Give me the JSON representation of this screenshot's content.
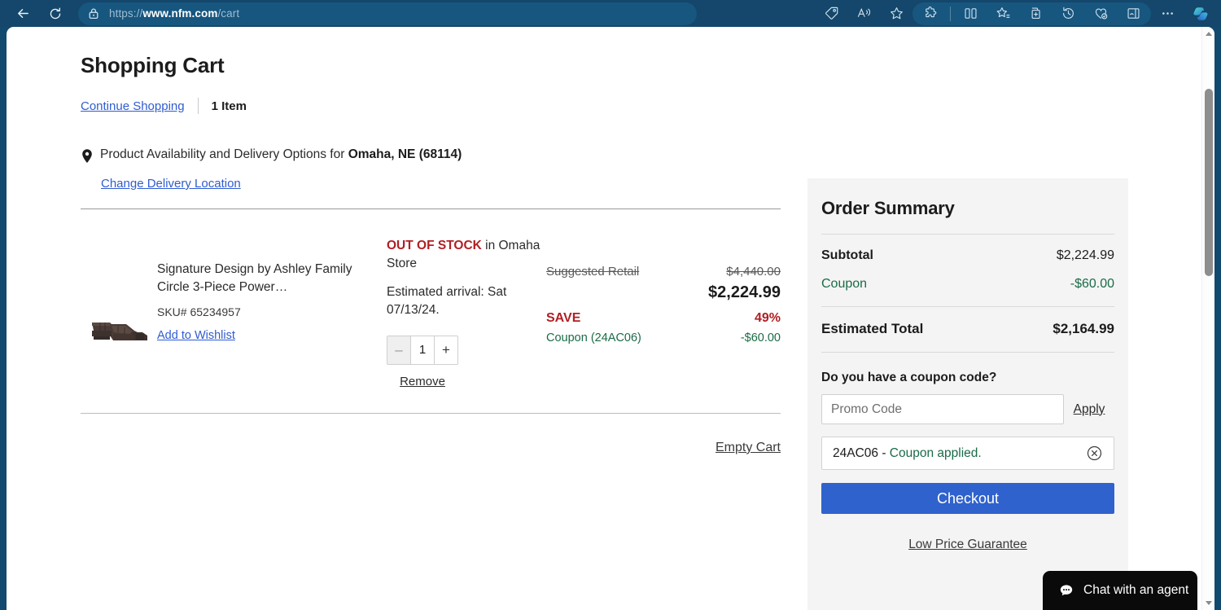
{
  "browser": {
    "url_prefix": "https://",
    "url_domain": "www.nfm.com",
    "url_path": "/cart",
    "back_icon": "back-arrow-icon",
    "refresh_icon": "refresh-icon",
    "lock_icon": "site-info-lock-icon",
    "toolbar_icons": [
      "price-tag-icon",
      "read-aloud-icon",
      "favorites-star-icon",
      "extensions-puzzle-icon",
      "split-screen-icon",
      "collections-star-icon",
      "add-to-collections-icon",
      "history-icon",
      "browser-essentials-icon",
      "sidebar-toggle-icon",
      "settings-more-icon",
      "copilot-icon"
    ]
  },
  "page": {
    "title": "Shopping Cart",
    "continue_shopping": "Continue Shopping",
    "item_count": "1 Item",
    "availability_prefix": "Product Availability and Delivery Options for ",
    "availability_location": "Omaha, NE (68114)",
    "change_location": "Change Delivery Location",
    "empty_cart": "Empty Cart"
  },
  "item": {
    "thumbnail": "sectional-sofa-thumbnail",
    "name": "Signature Design by Ashley Family Circle 3-Piece Power…",
    "sku": "SKU# 65234957",
    "add_to_wishlist": "Add to Wishlist",
    "stock_status": "OUT OF STOCK",
    "stock_suffix": " in Omaha Store",
    "estimated_arrival": "Estimated arrival: Sat 07/13/24.",
    "qty_minus": "–",
    "qty_value": "1",
    "qty_plus": "+",
    "remove": "Remove",
    "suggested_retail_label": "Suggested Retail",
    "suggested_retail_value": "$4,440.00",
    "current_price": "$2,224.99",
    "save_label": "SAVE",
    "save_percent": "49%",
    "coupon_label": "Coupon (24AC06)",
    "coupon_value": "-$60.00"
  },
  "summary": {
    "title": "Order Summary",
    "rows": [
      {
        "label": "Subtotal",
        "value": "$2,224.99",
        "green": false
      },
      {
        "label": "Coupon",
        "value": "-$60.00",
        "green": true
      }
    ],
    "total_label": "Estimated Total",
    "total_value": "$2,164.99",
    "coupon_question": "Do you have a coupon code?",
    "promo_placeholder": "Promo Code",
    "promo_value": "",
    "apply_label": "Apply",
    "applied_code": "24AC06 - ",
    "applied_status": "Coupon applied.",
    "remove_coupon_icon": "close-circle-icon",
    "checkout_label": "Checkout",
    "low_price_guarantee": "Low Price Guarantee"
  },
  "chat": {
    "label": "Chat with an agent",
    "icon": "chat-bubble-icon"
  },
  "colors": {
    "browser_chrome": "#14476b",
    "link": "#2f5cd0",
    "danger": "#b01f24",
    "success": "#1b6b48",
    "checkout": "#2f62cd",
    "summary_bg": "#f4f4f4"
  }
}
